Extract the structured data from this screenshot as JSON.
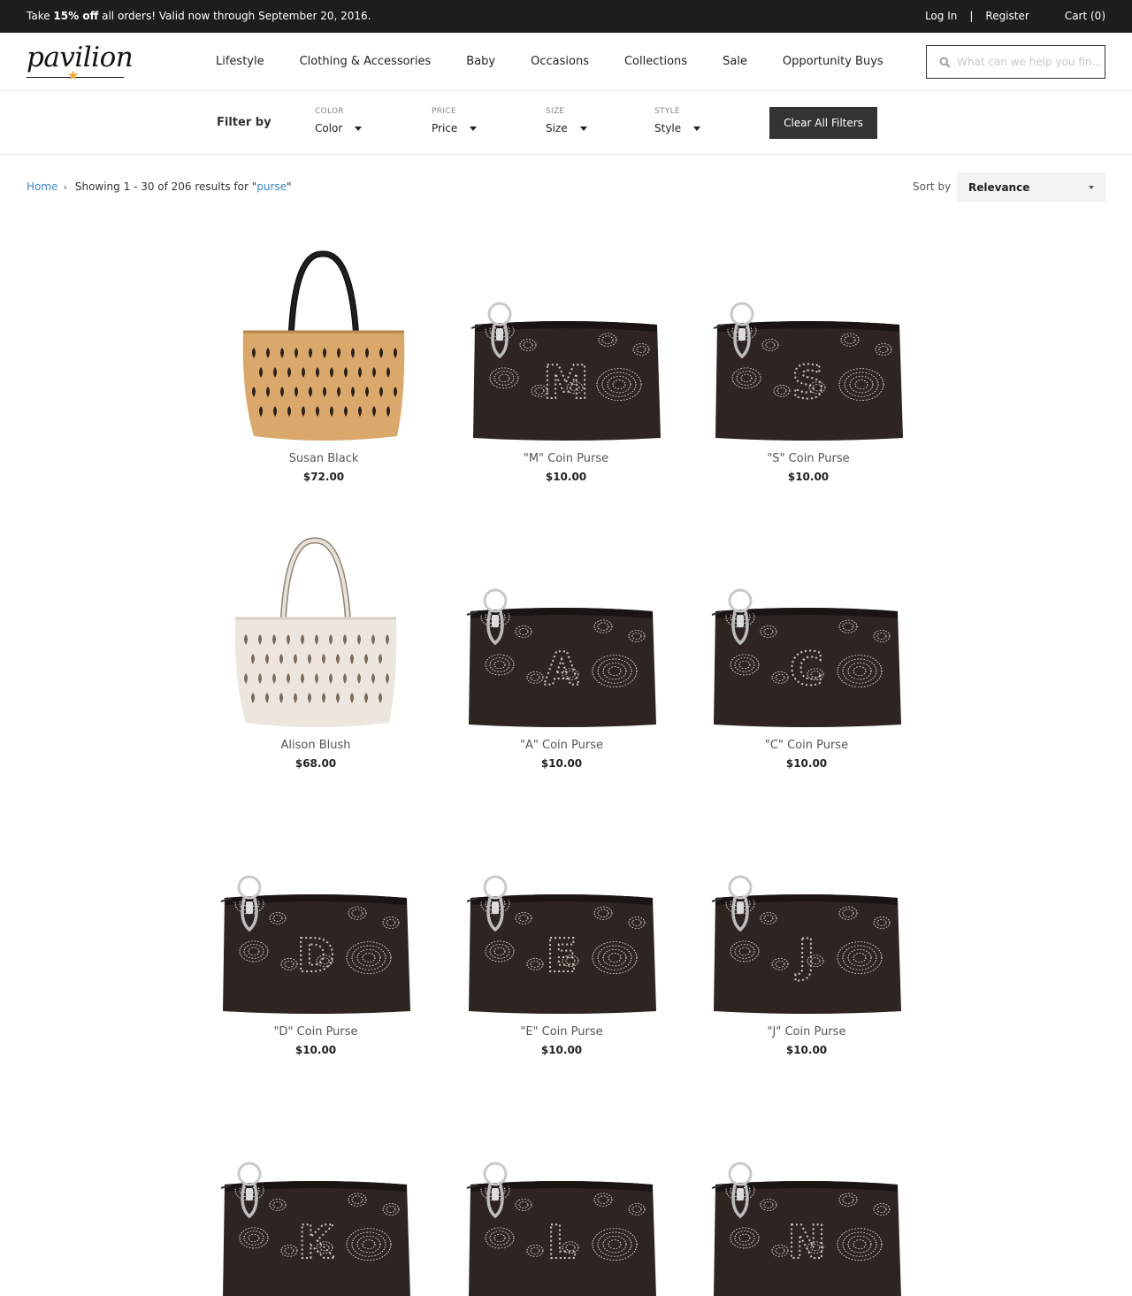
{
  "promo": {
    "prefix": "Take ",
    "highlight": "15% off",
    "suffix": " all orders! Valid now through September 20, 2016.",
    "login": "Log In",
    "separator": "|",
    "register": "Register",
    "cart": "Cart (0)"
  },
  "logo": {
    "text": "pavilion",
    "star": "★"
  },
  "nav": [
    {
      "label": "Lifestyle"
    },
    {
      "label": "Clothing & Accessories"
    },
    {
      "label": "Baby"
    },
    {
      "label": "Occasions"
    },
    {
      "label": "Collections"
    },
    {
      "label": "Sale"
    },
    {
      "label": "Opportunity Buys"
    }
  ],
  "search": {
    "placeholder": "What can we help you fin..."
  },
  "filters": {
    "label": "Filter by",
    "items": [
      {
        "caption": "COLOR",
        "value": "Color"
      },
      {
        "caption": "PRICE",
        "value": "Price"
      },
      {
        "caption": "SIZE",
        "value": "Size"
      },
      {
        "caption": "STYLE",
        "value": "Style"
      }
    ],
    "clear_label": "Clear All Filters"
  },
  "breadcrumb": {
    "home": "Home",
    "chevron": "›",
    "showing": "Showing 1 - 30 of 206 results for \"",
    "query": "purse",
    "close_quote": "\""
  },
  "sort": {
    "label": "Sort by",
    "value": "Relevance"
  },
  "colors": {
    "accent_link": "#3a87c8",
    "promo_bg": "#1d1d1d",
    "purse_leather": "#2e2422",
    "tote_tan": "#d9a86a",
    "tote_blush": "#ece6df",
    "logo_star": "#f0a92e"
  },
  "products": [
    {
      "name": "Susan Black",
      "price": "$72.00",
      "kind": "tote",
      "color": "tan",
      "letter": ""
    },
    {
      "name": "\"M\" Coin Purse",
      "price": "$10.00",
      "kind": "coin",
      "letter": "M"
    },
    {
      "name": "\"S\" Coin Purse",
      "price": "$10.00",
      "kind": "coin",
      "letter": "S"
    },
    {
      "name": "Alison Blush",
      "price": "$68.00",
      "kind": "tote",
      "color": "blush",
      "letter": ""
    },
    {
      "name": "\"A\" Coin Purse",
      "price": "$10.00",
      "kind": "coin",
      "letter": "A"
    },
    {
      "name": "\"C\" Coin Purse",
      "price": "$10.00",
      "kind": "coin",
      "letter": "C"
    },
    {
      "name": "\"D\" Coin Purse",
      "price": "$10.00",
      "kind": "coin",
      "letter": "D"
    },
    {
      "name": "\"E\" Coin Purse",
      "price": "$10.00",
      "kind": "coin",
      "letter": "E"
    },
    {
      "name": "\"J\" Coin Purse",
      "price": "$10.00",
      "kind": "coin",
      "letter": "J"
    },
    {
      "name": "",
      "price": "",
      "kind": "coin",
      "letter": "K"
    },
    {
      "name": "",
      "price": "",
      "kind": "coin",
      "letter": "L"
    },
    {
      "name": "",
      "price": "",
      "kind": "coin",
      "letter": "N"
    }
  ]
}
